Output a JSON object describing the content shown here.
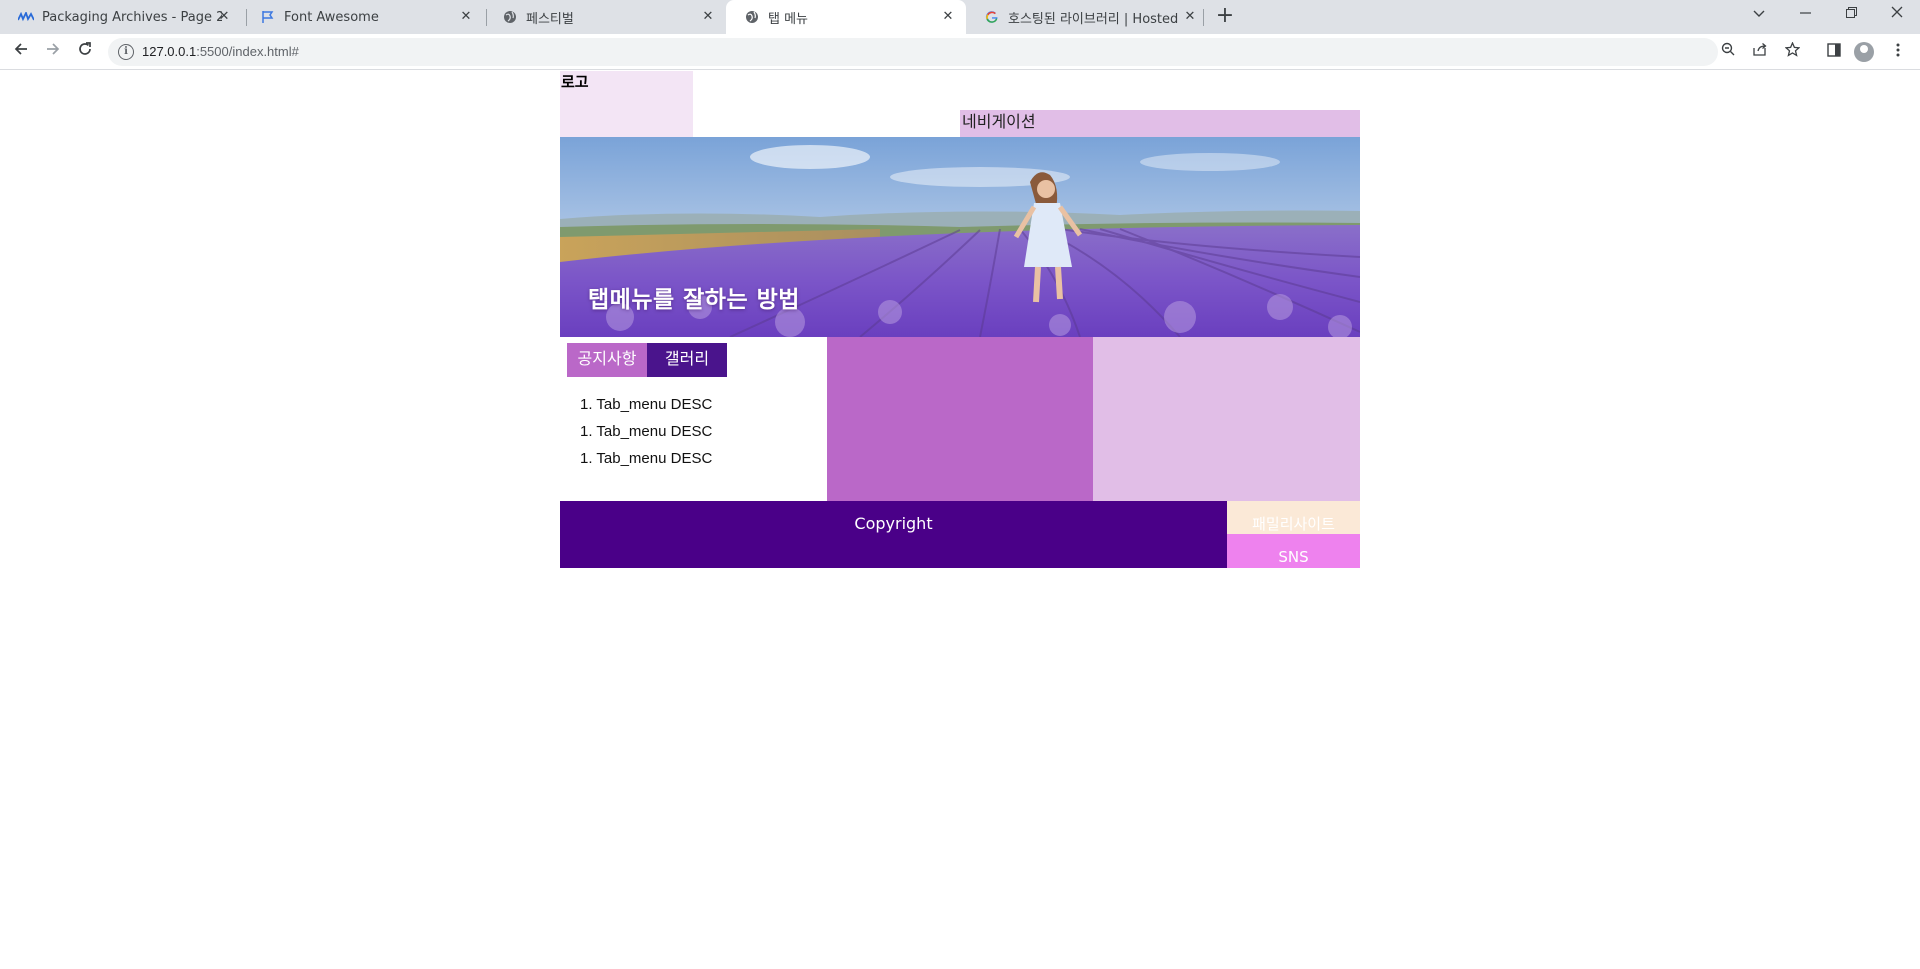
{
  "browser": {
    "tabs": [
      {
        "title": "Packaging Archives - Page 2 of",
        "icon": "wave-logo-icon"
      },
      {
        "title": "Font Awesome",
        "icon": "flag-icon"
      },
      {
        "title": "페스티벌",
        "icon": "globe-icon"
      },
      {
        "title": "탭 메뉴",
        "icon": "globe-icon",
        "active": true
      },
      {
        "title": "호스팅된 라이브러리 | Hosted",
        "icon": "google-icon"
      }
    ],
    "url_host": "127.0.0.1",
    "url_rest": ":5500/index.html#"
  },
  "page": {
    "logo": "로고",
    "navigation": "네비게이션",
    "banner_title": "탭메뉴를 잘하는 방법",
    "tabs": {
      "notice_label": "공지사항",
      "gallery_label": "갤러리"
    },
    "tab_items": [
      "1. Tab_menu DESC",
      "1. Tab_menu DESC",
      "1. Tab_menu DESC"
    ],
    "footer": {
      "copyright": "Copyright",
      "family_site": "패밀리사이트",
      "sns": "SNS"
    }
  },
  "colors": {
    "logo_bg": "#f3e5f5",
    "nav_bg": "#e1bee7",
    "notice_tab": "#ba68c8",
    "gallery_tab": "#4a148c",
    "box_mid": "#ba68c8",
    "box_right": "#e1bee7",
    "copyright_bg": "#4a0088",
    "family_bg": "#fbe9d7",
    "sns_bg": "#ee82ee"
  }
}
